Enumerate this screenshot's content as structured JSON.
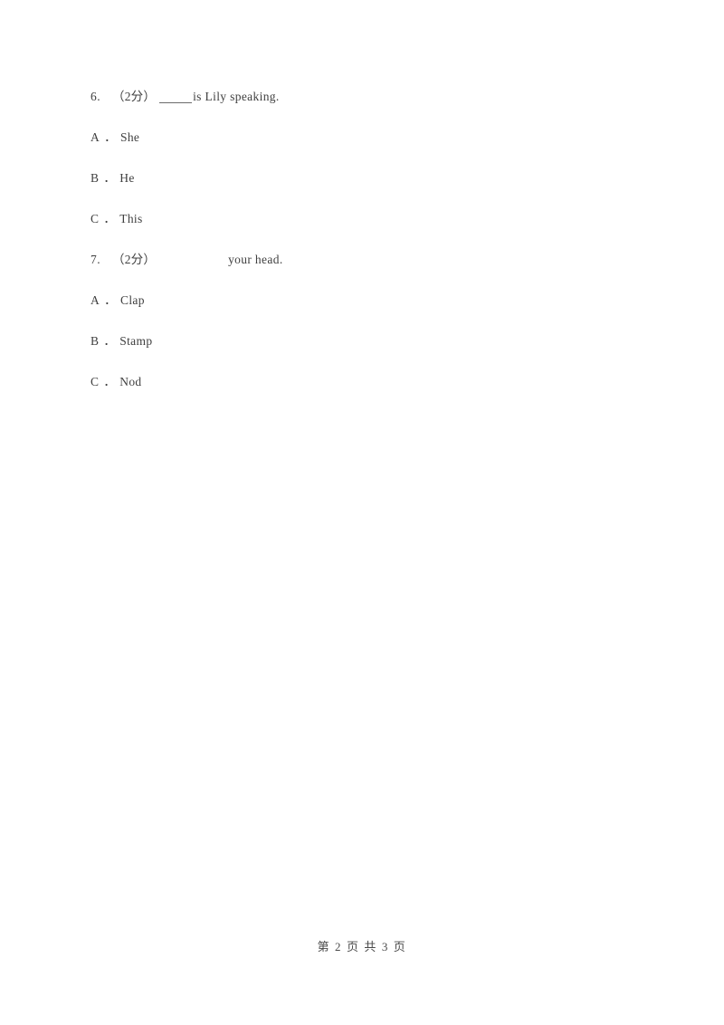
{
  "document": {
    "background_color": "#ffffff",
    "text_color": "#3f3f3f",
    "rule_color": "#6b6b6b"
  },
  "questions": [
    {
      "number": "6.",
      "score": "（2分）",
      "blank_style": "underline",
      "stem": "is Lily speaking.",
      "options": [
        {
          "letter": "A",
          "dot": "．",
          "text": "She"
        },
        {
          "letter": "B",
          "dot": "．",
          "text": "He"
        },
        {
          "letter": "C",
          "dot": "．",
          "text": "This"
        }
      ]
    },
    {
      "number": "7.",
      "score": "（2分）",
      "blank_style": "gap",
      "stem": "your head.",
      "options": [
        {
          "letter": "A",
          "dot": "．",
          "text": "Clap"
        },
        {
          "letter": "B",
          "dot": "．",
          "text": "Stamp"
        },
        {
          "letter": "C",
          "dot": "．",
          "text": "Nod"
        }
      ]
    }
  ],
  "footer": {
    "text": "第 2 页 共 3 页",
    "current_page": "2",
    "total_pages": "3"
  }
}
